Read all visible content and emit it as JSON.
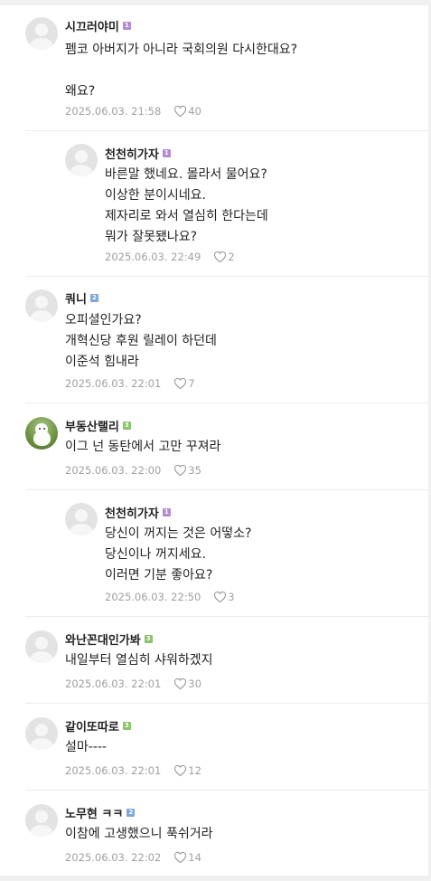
{
  "comments": [
    {
      "nick": "시끄러야미",
      "level": "1",
      "level_color": "#b38ad3",
      "avatar": "default",
      "text": "펨코 아버지가 아니라 국회의원 다시한대요?\n\n왜요?",
      "date": "2025.06.03. 21:58",
      "likes": "40",
      "reply": false
    },
    {
      "nick": "천천히가자",
      "level": "1",
      "level_color": "#b38ad3",
      "avatar": "default",
      "text": "바른말 했네요. 몰라서 물어요?\n이상한 분이시네요.\n제자리로 와서 열심히 한다는데\n뭐가 잘못됐나요?",
      "date": "2025.06.03. 22:49",
      "likes": "2",
      "reply": true
    },
    {
      "nick": "쿼니",
      "level": "2",
      "level_color": "#7fa6d6",
      "avatar": "default",
      "text": "오피셜인가요?\n개혁신당 후원 릴레이 하던데\n이준석 힘내라",
      "date": "2025.06.03. 22:01",
      "likes": "7",
      "reply": false
    },
    {
      "nick": "부동산랠리",
      "level": "3",
      "level_color": "#8cc26a",
      "avatar": "dog-photo",
      "text": "이그 넌 동탄에서 고만 꾸져라",
      "date": "2025.06.03. 22:00",
      "likes": "35",
      "reply": false
    },
    {
      "nick": "천천히가자",
      "level": "1",
      "level_color": "#b38ad3",
      "avatar": "default",
      "text": "당신이 꺼지는 것은 어떻소?\n당신이나 꺼지세요.\n이러면 기분 좋아요?",
      "date": "2025.06.03. 22:50",
      "likes": "3",
      "reply": true
    },
    {
      "nick": "와난꼰대인가봐",
      "level": "3",
      "level_color": "#8cc26a",
      "avatar": "default",
      "text": "내일부터 열심히 샤워하겠지",
      "date": "2025.06.03. 22:01",
      "likes": "30",
      "reply": false
    },
    {
      "nick": "같이또따로",
      "level": "3",
      "level_color": "#8cc26a",
      "avatar": "default",
      "text": "설마----",
      "date": "2025.06.03. 22:01",
      "likes": "12",
      "reply": false
    },
    {
      "nick": "노무현 ㅋㅋ",
      "level": "2",
      "level_color": "#7fa6d6",
      "avatar": "default",
      "text": "이참에 고생했으니 푹쉬거라",
      "date": "2025.06.03. 22:02",
      "likes": "14",
      "reply": false
    }
  ],
  "icons": {
    "like": "heart-icon",
    "avatar": "default-avatar-icon"
  }
}
